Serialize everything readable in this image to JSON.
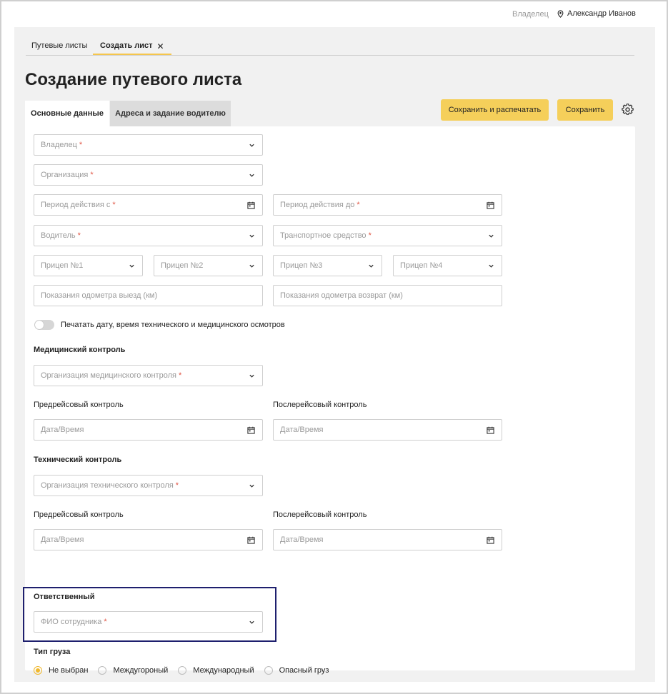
{
  "header": {
    "role": "Владелец",
    "user_name": "Александр Иванов"
  },
  "doc_tabs": [
    {
      "label": "Путевые листы"
    },
    {
      "label": "Создать лист"
    }
  ],
  "page_title": "Создание путевого листа",
  "section_tabs": [
    {
      "label": "Основные данные",
      "active": true
    },
    {
      "label": "Адреса и задание водителю",
      "active": false
    }
  ],
  "actions": {
    "save_print": "Сохранить и распечатать",
    "save": "Сохранить"
  },
  "fields": {
    "owner": "Владелец",
    "organization": "Организация",
    "period_from": "Период действия с",
    "period_to": "Период действия до",
    "driver": "Водитель",
    "vehicle": "Транспортное средство",
    "trailer1": "Прицеп №1",
    "trailer2": "Прицеп №2",
    "trailer3": "Прицеп №3",
    "trailer4": "Прицеп №4",
    "odometer_out": "Показания одометра выезд (км)",
    "odometer_back": "Показания одометра возврат (км)"
  },
  "print_toggle": {
    "label": "Печатать дату, время технического и медицинского осмотров",
    "on": false
  },
  "medical": {
    "heading": "Медицинский контроль",
    "org_placeholder": "Организация медицинского контроля",
    "pre_label": "Предрейсовый контроль",
    "post_label": "Послерейсовый контроль",
    "pre_placeholder": "Дата/Время",
    "post_placeholder": "Дата/Время"
  },
  "technical": {
    "heading": "Технический контроль",
    "org_placeholder": "Организация технического контроля",
    "pre_label": "Предрейсовый контроль",
    "post_label": "Послерейсовый контроль",
    "pre_placeholder": "Дата/Время",
    "post_placeholder": "Дата/Время"
  },
  "responsible": {
    "heading": "Ответственный",
    "placeholder": "ФИО сотрудника"
  },
  "cargo": {
    "heading": "Тип груза",
    "options": [
      {
        "label": "Не выбран",
        "selected": true
      },
      {
        "label": "Междугороный",
        "selected": false
      },
      {
        "label": "Международный",
        "selected": false
      },
      {
        "label": "Опасный груз",
        "selected": false
      }
    ]
  },
  "required_mark": "*",
  "colors": {
    "accent": "#f5cf5a",
    "highlight_border": "#1e1f6e",
    "required": "#e05545"
  }
}
